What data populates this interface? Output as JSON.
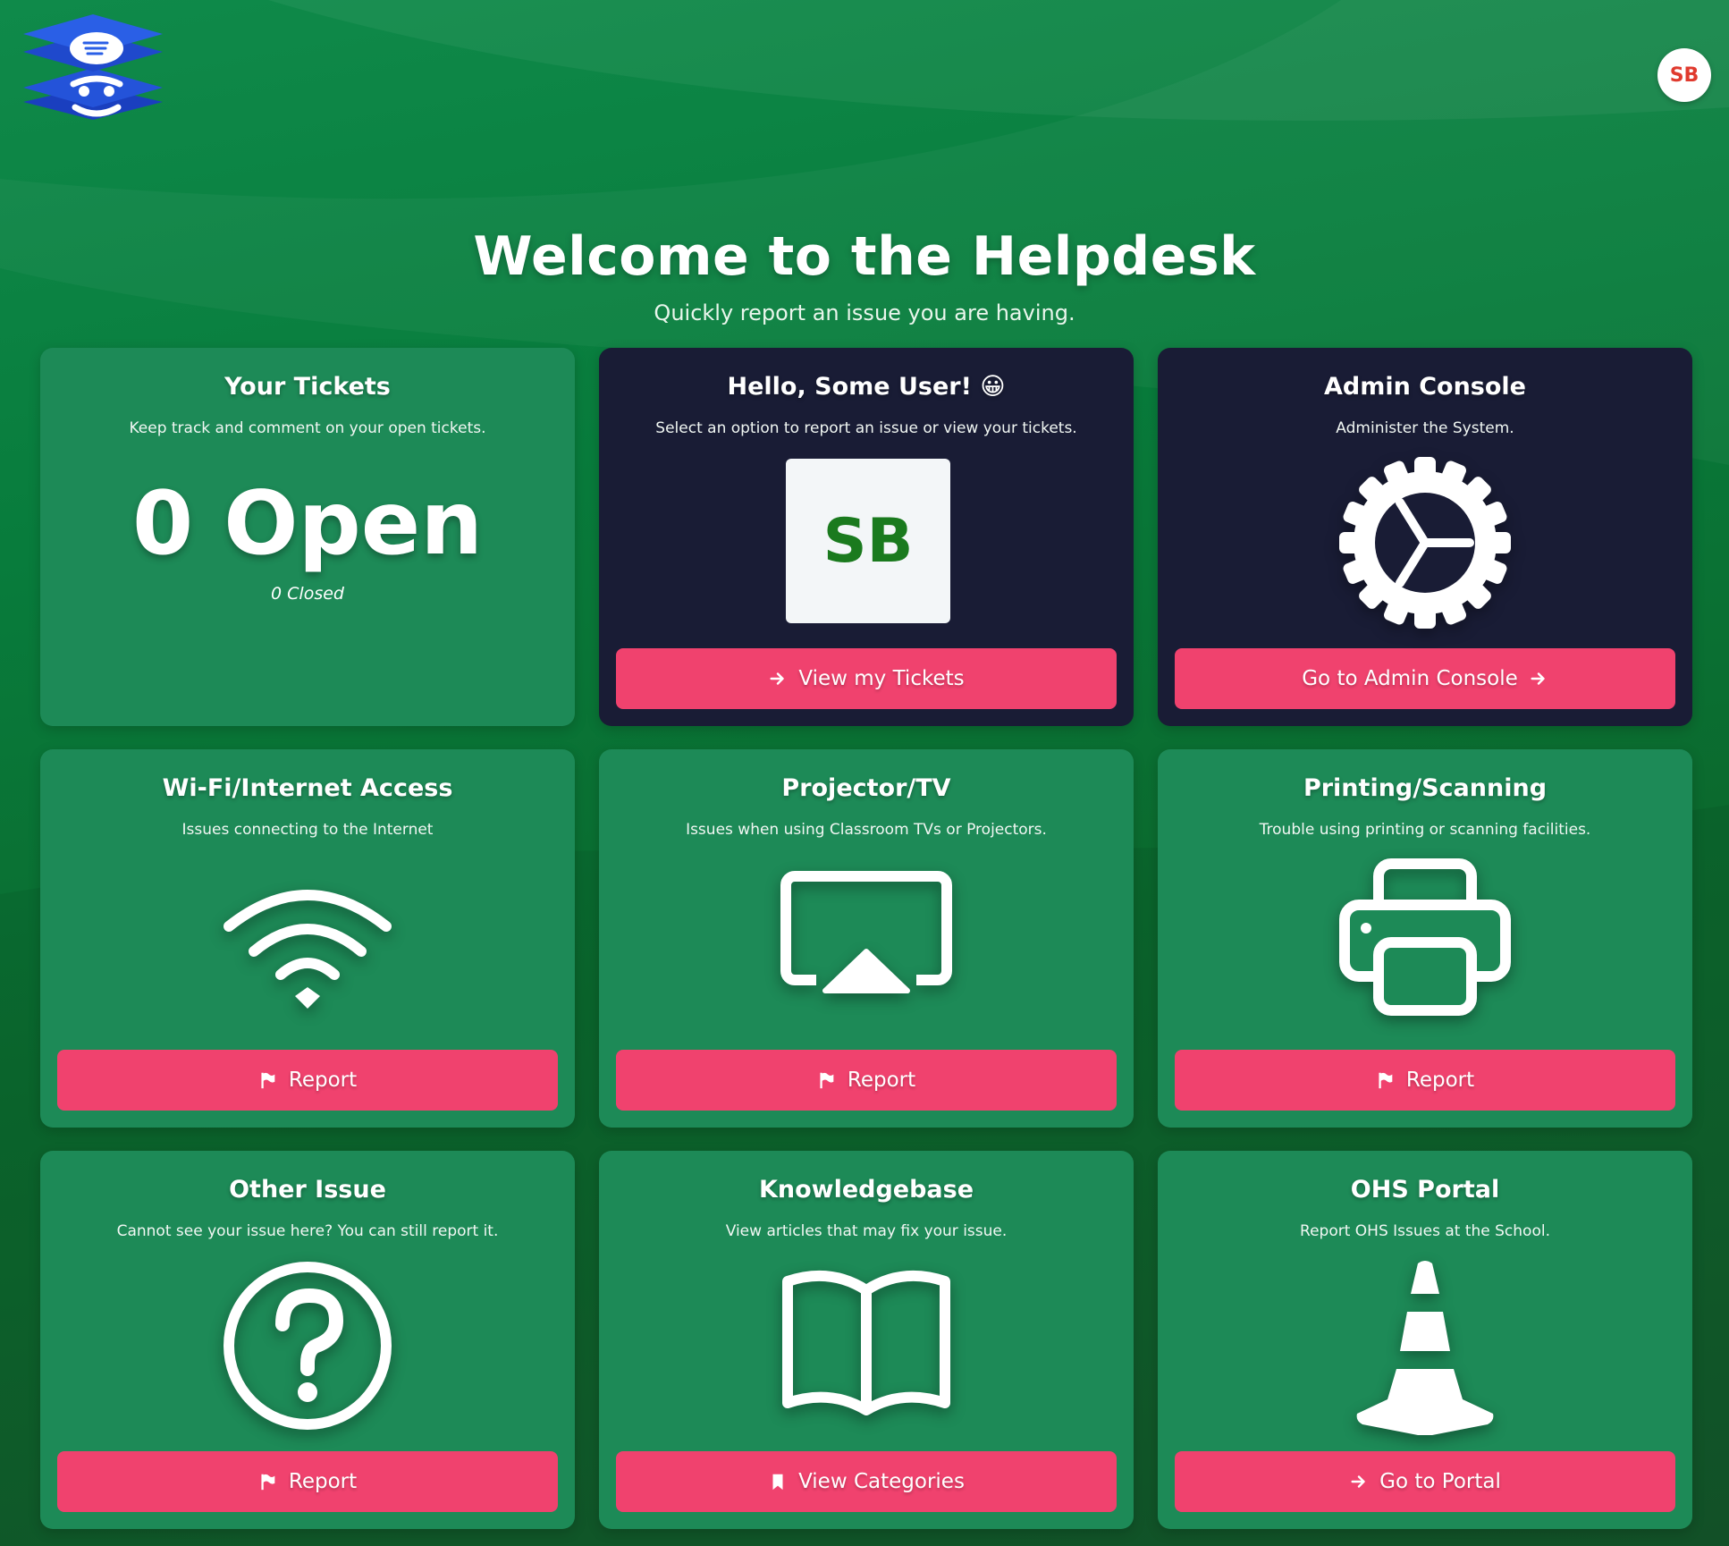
{
  "header": {
    "avatar_initials": "SB",
    "logo_icon": "helpdesk-stack-logo"
  },
  "hero": {
    "title": "Welcome to the Helpdesk",
    "subtitle": "Quickly report an issue you are having."
  },
  "cards": {
    "tickets": {
      "title": "Your Tickets",
      "desc": "Keep track and comment on your open tickets.",
      "open": "0 Open",
      "closed": "0 Closed"
    },
    "hello": {
      "title": "Hello, Some User! 😀",
      "desc": "Select an option to report an issue or view your tickets.",
      "avatar": "SB",
      "button": "View my Tickets"
    },
    "admin": {
      "title": "Admin Console",
      "desc": "Administer the System.",
      "button": "Go to Admin Console",
      "icon": "gear-icon"
    },
    "wifi": {
      "title": "Wi-Fi/Internet Access",
      "desc": "Issues connecting to the Internet",
      "button": "Report",
      "icon": "wifi-icon"
    },
    "projector": {
      "title": "Projector/TV",
      "desc": "Issues when using Classroom TVs or Projectors.",
      "button": "Report",
      "icon": "screen-cast-icon"
    },
    "printing": {
      "title": "Printing/Scanning",
      "desc": "Trouble using printing or scanning facilities.",
      "button": "Report",
      "icon": "printer-icon"
    },
    "other": {
      "title": "Other Issue",
      "desc": "Cannot see your issue here? You can still report it.",
      "button": "Report",
      "icon": "question-icon"
    },
    "kb": {
      "title": "Knowledgebase",
      "desc": "View articles that may fix your issue.",
      "button": "View Categories",
      "icon": "book-icon"
    },
    "ohs": {
      "title": "OHS Portal",
      "desc": "Report OHS Issues at the School.",
      "button": "Go to Portal",
      "icon": "traffic-cone-icon"
    }
  },
  "colors": {
    "card_green": "#1d8a57",
    "card_dark": "#191c35",
    "button_pink": "#f0426e",
    "avatar_text_red": "#e03a2e",
    "sb_green": "#1a7a1e"
  }
}
